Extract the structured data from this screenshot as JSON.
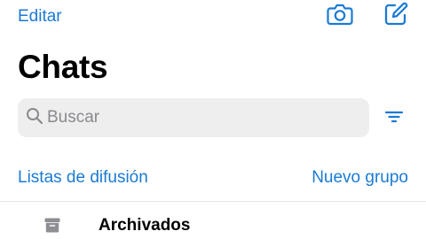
{
  "header": {
    "edit_label": "Editar",
    "camera_icon": "camera-icon",
    "compose_icon": "compose-icon"
  },
  "title": "Chats",
  "search": {
    "placeholder": "Buscar",
    "value": "",
    "icon": "search-icon"
  },
  "filter_icon": "filter-icon",
  "links": {
    "broadcast_lists": "Listas de difusión",
    "new_group": "Nuevo grupo"
  },
  "archived": {
    "label": "Archivados",
    "icon": "archive-box-icon"
  },
  "colors": {
    "accent": "#1a7ad4",
    "search_bg": "#eeeeef",
    "placeholder": "#8a8a8e",
    "divider": "#e4e4e6"
  }
}
